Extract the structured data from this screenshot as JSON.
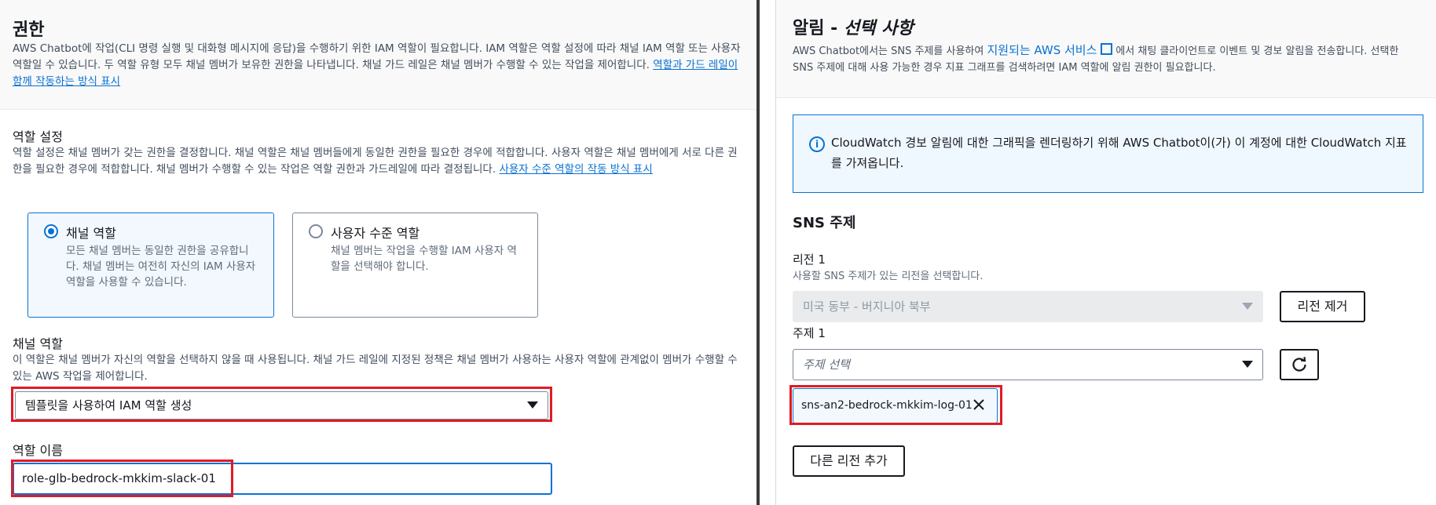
{
  "permissions": {
    "title": "권한",
    "description": "AWS Chatbot에 작업(CLI 명령 실행 및 대화형 메시지에 응답)을 수행하기 위한 IAM 역할이 필요합니다. IAM 역할은 역할 설정에 따라 채널 IAM 역할 또는 사용자 역할일 수 있습니다. 두 역할 유형 모두 채널 멤버가 보유한 권한을 나타냅니다. 채널 가드 레일은 채널 멤버가 수행할 수 있는 작업을 제어합니다.",
    "link": "역할과 가드 레일이 함께 작동하는 방식 표시",
    "role_settings": {
      "label": "역할 설정",
      "description": "역할 설정은 채널 멤버가 갖는 권한을 결정합니다. 채널 역할은 채널 멤버들에게 동일한 권한을 필요한 경우에 적합합니다. 사용자 역할은 채널 멤버에게 서로 다른 권한을 필요한 경우에 적합합니다. 채널 멤버가 수행할 수 있는 작업은 역할 권한과 가드레일에 따라 결정됩니다.",
      "link": "사용자 수준 역할의 작동 방식 표시",
      "options": [
        {
          "title": "채널 역할",
          "description": "모든 채널 멤버는 동일한 권한을 공유합니다. 채널 멤버는 여전히 자신의 IAM 사용자 역할을 사용할 수 있습니다.",
          "selected": true
        },
        {
          "title": "사용자 수준 역할",
          "description": "채널 멤버는 작업을 수행할 IAM 사용자 역할을 선택해야 합니다.",
          "selected": false
        }
      ]
    },
    "channel_role": {
      "label": "채널 역할",
      "description": "이 역할은 채널 멤버가 자신의 역할을 선택하지 않을 때 사용됩니다. 채널 가드 레일에 지정된 정책은 채널 멤버가 사용하는 사용자 역할에 관계없이 멤버가 수행할 수 있는 AWS 작업을 제어합니다.",
      "selected": "템플릿을 사용하여 IAM 역할 생성"
    },
    "role_name": {
      "label": "역할 이름",
      "value": "role-glb-bedrock-mkkim-slack-01"
    }
  },
  "notifications": {
    "title_plain": "알림 - ",
    "title_italic": "선택 사항",
    "desc_before": "AWS Chatbot에서는 SNS 주제를 사용하여 ",
    "desc_link": "지원되는 AWS 서비스",
    "desc_after": " 에서 채팅 클라이언트로 이벤트 및 경보 알림을 전송합니다. 선택한 SNS 주제에 대해 사용 가능한 경우 지표 그래프를 검색하려면 IAM 역할에 알림 권한이 필요합니다.",
    "info": "CloudWatch 경보 알림에 대한 그래픽을 렌더링하기 위해 AWS Chatbot이(가) 이 계정에 대한 CloudWatch 지표를 가져옵니다.",
    "sns": {
      "heading": "SNS 주제",
      "region_label": "리전 1",
      "region_hint": "사용할 SNS 주제가 있는 리전을 선택합니다.",
      "region_value": "미국 동부 - 버지니아 북부",
      "remove_region": "리전 제거",
      "topic_label": "주제 1",
      "topic_placeholder": "주제 선택",
      "token": "sns-an2-bedrock-mkkim-log-01",
      "add_region": "다른 리전 추가"
    }
  }
}
